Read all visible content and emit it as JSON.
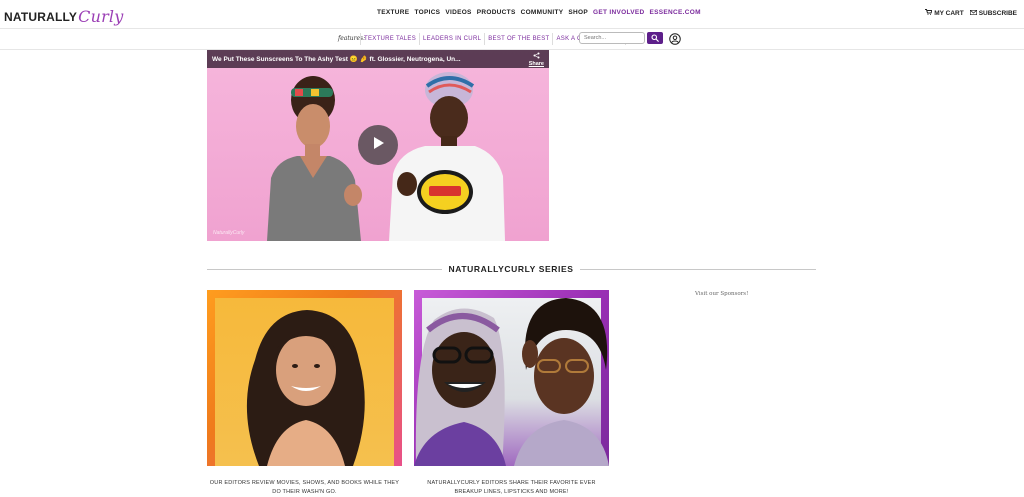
{
  "header": {
    "logo_main": "NATURALLY",
    "logo_script": "Curly",
    "nav": [
      "TEXTURE",
      "TOPICS",
      "VIDEOS",
      "PRODUCTS",
      "COMMUNITY",
      "SHOP",
      "GET INVOLVED",
      "ESSENCE.COM"
    ],
    "cart": "MY CART",
    "subscribe": "SUBSCRIBE"
  },
  "features": {
    "label": "features:",
    "links": [
      "TEXTURE TALES",
      "LEADERS IN CURL",
      "BEST OF THE BEST",
      "ASK A CURL EXPERT"
    ],
    "search_placeholder": "Search..."
  },
  "video": {
    "title": "We Put These Sunscreens To The Ashy Test 😑 🤌 ft. Glossier, Neutrogena, Un...",
    "share": "Share",
    "watermark": "NaturallyCurly"
  },
  "series": {
    "heading": "NATURALLYCURLY SERIES",
    "cards": [
      {
        "caption": "OUR EDITORS REVIEW MOVIES, SHOWS, AND BOOKS WHILE THEY DO THEIR WASH'N GO."
      },
      {
        "caption": "NATURALLYCURLY EDITORS SHARE THEIR FAVORITE EVER BREAKUP LINES, LIPSTICKS AND MORE!"
      }
    ]
  },
  "sidebar": {
    "sponsors": "Visit our Sponsors!"
  },
  "colors": {
    "brand_purple": "#7b2b9d",
    "search_button": "#5d1f8a"
  }
}
